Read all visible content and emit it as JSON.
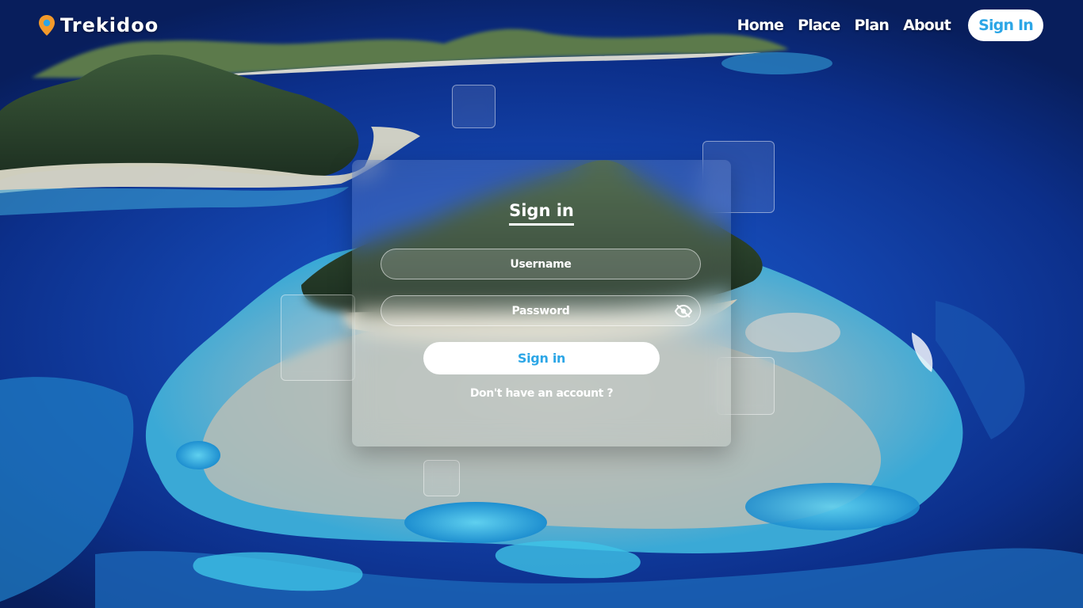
{
  "colors": {
    "accent": "#2ca6e6",
    "ocean": "#1446b0",
    "lagoon": "#35b8e0",
    "brand_pin": "#f39a2b"
  },
  "navbar": {
    "brand": {
      "icon": "map-pin-icon",
      "name": "Trekidoo"
    },
    "links": [
      {
        "label": "Home"
      },
      {
        "label": "Place"
      },
      {
        "label": "Plan"
      },
      {
        "label": "About"
      }
    ],
    "signin_button": {
      "label": "Sign In"
    }
  },
  "login": {
    "title": "Sign in",
    "username": {
      "placeholder": "Username",
      "value": ""
    },
    "password": {
      "placeholder": "Password",
      "value": "",
      "toggle_icon": "eye-slash-icon"
    },
    "submit_label": "Sign in",
    "register_link": "Don't have an account ?"
  }
}
